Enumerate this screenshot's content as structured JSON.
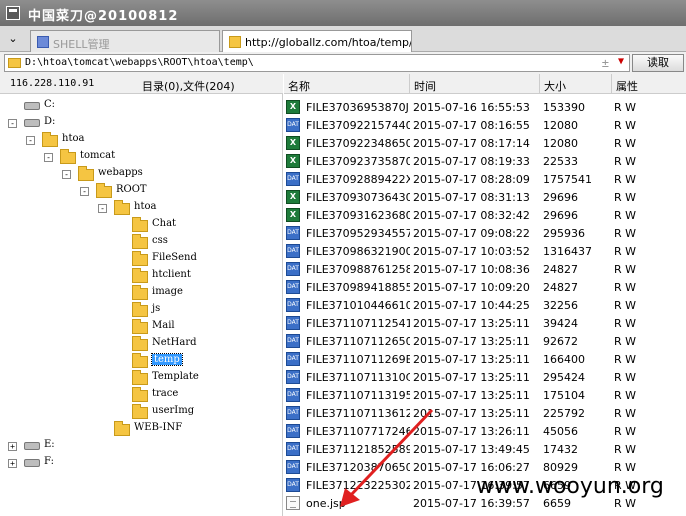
{
  "window": {
    "title": "中国菜刀@20100812"
  },
  "tabs": [
    {
      "label": "SHELL管理",
      "icon": "shell-icon"
    },
    {
      "label": "http://globallz.com/htoa/temp/o...",
      "icon": "folder-icon"
    }
  ],
  "address": {
    "value": "D:\\htoa\\tomcat\\webapps\\ROOT\\htoa\\temp\\",
    "read_button": "读取",
    "plus_minus": "±"
  },
  "left_header": {
    "ip": "116.228.110.91",
    "count": "目录(0),文件(204)"
  },
  "tree": [
    {
      "label": "C:",
      "type": "drive",
      "depth": 0,
      "toggle": ""
    },
    {
      "label": "D:",
      "type": "drive",
      "depth": 0,
      "toggle": "-"
    },
    {
      "label": "htoa",
      "type": "folder",
      "depth": 1,
      "toggle": "-"
    },
    {
      "label": "tomcat",
      "type": "folder",
      "depth": 2,
      "toggle": "-"
    },
    {
      "label": "webapps",
      "type": "folder",
      "depth": 3,
      "toggle": "-"
    },
    {
      "label": "ROOT",
      "type": "folder",
      "depth": 4,
      "toggle": "-"
    },
    {
      "label": "htoa",
      "type": "folder",
      "depth": 5,
      "toggle": "-"
    },
    {
      "label": "Chat",
      "type": "folder",
      "depth": 6,
      "toggle": ""
    },
    {
      "label": "css",
      "type": "folder",
      "depth": 6,
      "toggle": ""
    },
    {
      "label": "FileSend",
      "type": "folder",
      "depth": 6,
      "toggle": ""
    },
    {
      "label": "htclient",
      "type": "folder",
      "depth": 6,
      "toggle": ""
    },
    {
      "label": "image",
      "type": "folder",
      "depth": 6,
      "toggle": ""
    },
    {
      "label": "js",
      "type": "folder",
      "depth": 6,
      "toggle": ""
    },
    {
      "label": "Mail",
      "type": "folder",
      "depth": 6,
      "toggle": ""
    },
    {
      "label": "NetHard",
      "type": "folder",
      "depth": 6,
      "toggle": ""
    },
    {
      "label": "temp",
      "type": "folder",
      "depth": 6,
      "toggle": "",
      "selected": true
    },
    {
      "label": "Template",
      "type": "folder",
      "depth": 6,
      "toggle": ""
    },
    {
      "label": "trace",
      "type": "folder",
      "depth": 6,
      "toggle": ""
    },
    {
      "label": "userImg",
      "type": "folder",
      "depth": 6,
      "toggle": ""
    },
    {
      "label": "WEB-INF",
      "type": "folder",
      "depth": 5,
      "toggle": ""
    },
    {
      "label": "E:",
      "type": "drive",
      "depth": 0,
      "toggle": "+"
    },
    {
      "label": "F:",
      "type": "drive",
      "depth": 0,
      "toggle": "+"
    }
  ],
  "columns": {
    "name": "名称",
    "time": "时间",
    "size": "大小",
    "attr": "属性"
  },
  "files": [
    {
      "name": "FILE37036953870J...",
      "time": "2015-07-16 16:55:53",
      "size": "153390",
      "attr": "R W",
      "icon": "xls"
    },
    {
      "name": "FILE370922157440...",
      "time": "2015-07-17 08:16:55",
      "size": "12080",
      "attr": "R W",
      "icon": "dat"
    },
    {
      "name": "FILE370922348650...",
      "time": "2015-07-17 08:17:14",
      "size": "12080",
      "attr": "R W",
      "icon": "xls"
    },
    {
      "name": "FILE370923735870...",
      "time": "2015-07-17 08:19:33",
      "size": "22533",
      "attr": "R W",
      "icon": "xls"
    },
    {
      "name": "FILE37092889422X...",
      "time": "2015-07-17 08:28:09",
      "size": "1757541",
      "attr": "R W",
      "icon": "dat"
    },
    {
      "name": "FILE370930736430...",
      "time": "2015-07-17 08:31:13",
      "size": "29696",
      "attr": "R W",
      "icon": "xls"
    },
    {
      "name": "FILE370931623680...",
      "time": "2015-07-17 08:32:42",
      "size": "29696",
      "attr": "R W",
      "icon": "xls"
    },
    {
      "name": "FILE370952934557...",
      "time": "2015-07-17 09:08:22",
      "size": "295936",
      "attr": "R W",
      "icon": "dat"
    },
    {
      "name": "FILE370986321900...",
      "time": "2015-07-17 10:03:52",
      "size": "1316437",
      "attr": "R W",
      "icon": "dat"
    },
    {
      "name": "FILE370988761258...",
      "time": "2015-07-17 10:08:36",
      "size": "24827",
      "attr": "R W",
      "icon": "dat"
    },
    {
      "name": "FILE370989418855...",
      "time": "2015-07-17 10:09:20",
      "size": "24827",
      "attr": "R W",
      "icon": "dat"
    },
    {
      "name": "FILE371010446610...",
      "time": "2015-07-17 10:44:25",
      "size": "32256",
      "attr": "R W",
      "icon": "dat"
    },
    {
      "name": "FILE371107112541...",
      "time": "2015-07-17 13:25:11",
      "size": "39424",
      "attr": "R W",
      "icon": "dat"
    },
    {
      "name": "FILE371107112650...",
      "time": "2015-07-17 13:25:11",
      "size": "92672",
      "attr": "R W",
      "icon": "dat"
    },
    {
      "name": "FILE37110711269E...",
      "time": "2015-07-17 13:25:11",
      "size": "166400",
      "attr": "R W",
      "icon": "dat"
    },
    {
      "name": "FILE37110711310C...",
      "time": "2015-07-17 13:25:11",
      "size": "295424",
      "attr": "R W",
      "icon": "dat"
    },
    {
      "name": "FILE371107113195...",
      "time": "2015-07-17 13:25:11",
      "size": "175104",
      "attr": "R W",
      "icon": "dat"
    },
    {
      "name": "FILE371107113612...",
      "time": "2015-07-17 13:25:11",
      "size": "225792",
      "attr": "R W",
      "icon": "dat"
    },
    {
      "name": "FILE371107717246...",
      "time": "2015-07-17 13:26:11",
      "size": "45056",
      "attr": "R W",
      "icon": "dat"
    },
    {
      "name": "FILE371121852589...",
      "time": "2015-07-17 13:49:45",
      "size": "17432",
      "attr": "R W",
      "icon": "dat"
    },
    {
      "name": "FILE371203870650...",
      "time": "2015-07-17 16:06:27",
      "size": "80929",
      "attr": "R W",
      "icon": "dat"
    },
    {
      "name": "FILE371223225302...",
      "time": "2015-07-17 16:39:57",
      "size": "6659",
      "attr": "R W",
      "icon": "dat"
    },
    {
      "name": "one.jsp",
      "time": "2015-07-17 16:39:57",
      "size": "6659",
      "attr": "R W",
      "icon": "jsp"
    }
  ],
  "annotation": {
    "arrow_color": "#e02020"
  },
  "watermark": {
    "text": "www.wooyun.org"
  }
}
